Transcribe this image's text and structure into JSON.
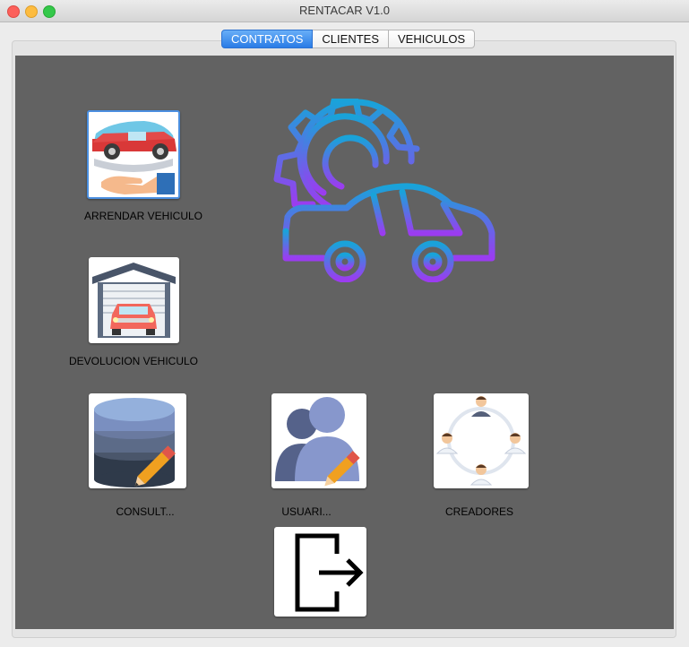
{
  "window": {
    "title": "RENTACAR V1.0"
  },
  "tabs": [
    {
      "label": "CONTRATOS",
      "active": true
    },
    {
      "label": "CLIENTES",
      "active": false
    },
    {
      "label": "VEHICULOS",
      "active": false
    }
  ],
  "actions": {
    "rent": {
      "label": "ARRENDAR VEHICULO",
      "icon": "car-in-hand-icon"
    },
    "return": {
      "label": "DEVOLUCION VEHICULO",
      "icon": "garage-car-icon"
    },
    "query": {
      "label": "CONSULT...",
      "icon": "database-edit-icon"
    },
    "users": {
      "label": "USUARI...",
      "icon": "users-edit-icon"
    },
    "creators": {
      "label": "CREADORES",
      "icon": "team-network-icon"
    },
    "exit": {
      "label": "",
      "icon": "exit-door-icon"
    }
  },
  "hero": {
    "icon": "car-gear-logo-icon"
  },
  "colors": {
    "content_bg": "#626262",
    "tab_active": "#2a7ce6",
    "gradient_top": "#19a3d9",
    "gradient_bottom": "#9b3cf0"
  }
}
